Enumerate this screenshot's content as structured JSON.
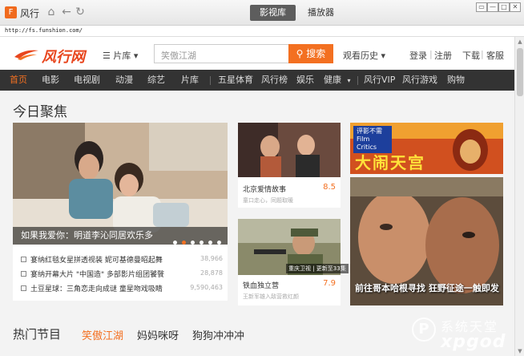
{
  "titlebar": {
    "app_name": "风行",
    "logo_glyph": "F",
    "tabs": [
      {
        "label": "影视库",
        "active": true
      },
      {
        "label": "播放器",
        "active": false
      }
    ],
    "window_buttons": [
      "▭",
      "—",
      "□",
      "✕"
    ]
  },
  "address": {
    "url": "http://fs.funshion.com/"
  },
  "header": {
    "brand": "风行网",
    "library": "片库",
    "search_placeholder": "笑傲江湖",
    "search_button": "搜索",
    "history": "观看历史",
    "login": "登录",
    "register": "注册",
    "download": "下载",
    "client": "客服"
  },
  "navbar": {
    "items": [
      "首页",
      "电影",
      "电视剧",
      "动漫",
      "综艺",
      "片库",
      "五星体育",
      "风行榜",
      "娱乐",
      "健康",
      "风行VIP",
      "风行游戏",
      "购物"
    ]
  },
  "today": {
    "title": "今日聚焦",
    "featured_caption": "如果我爱你：明道李沁同居欢乐多",
    "news": [
      {
        "text": "宴纳红毯女星拼透视装 妮可基德曼昭起舞",
        "count": "38,966"
      },
      {
        "text": "宴纳开幕大片 \"中国造\" 多部影片组团饕餮",
        "count": "28,878"
      },
      {
        "text": "土豆星球：三角恋走向成谜 童星吻戏吸睛",
        "count": "9,590,463"
      }
    ],
    "cards": [
      {
        "title": "北京爱情故事",
        "score": "8.5",
        "sub": "童口走心，同题取暖"
      },
      {
        "title": "铁血独立营",
        "score": "7.9",
        "sub": "王新军雄入敌营救红颜",
        "badge": "重庆卫视 | 更新至33集"
      }
    ],
    "poster1_label": "评影不需 Film Critics",
    "poster1_title": "大闹天宫",
    "poster2_text": "前往哥本哈根寻找 狂野征途一触即发"
  },
  "hot": {
    "title": "热门节目",
    "tabs": [
      {
        "label": "笑傲江湖",
        "active": true
      },
      {
        "label": "妈妈咪呀",
        "active": false
      },
      {
        "label": "狗狗冲冲冲",
        "active": false
      }
    ]
  },
  "watermark": {
    "line1": "系统天堂",
    "line2": "xpgod",
    "glyph": "P"
  }
}
